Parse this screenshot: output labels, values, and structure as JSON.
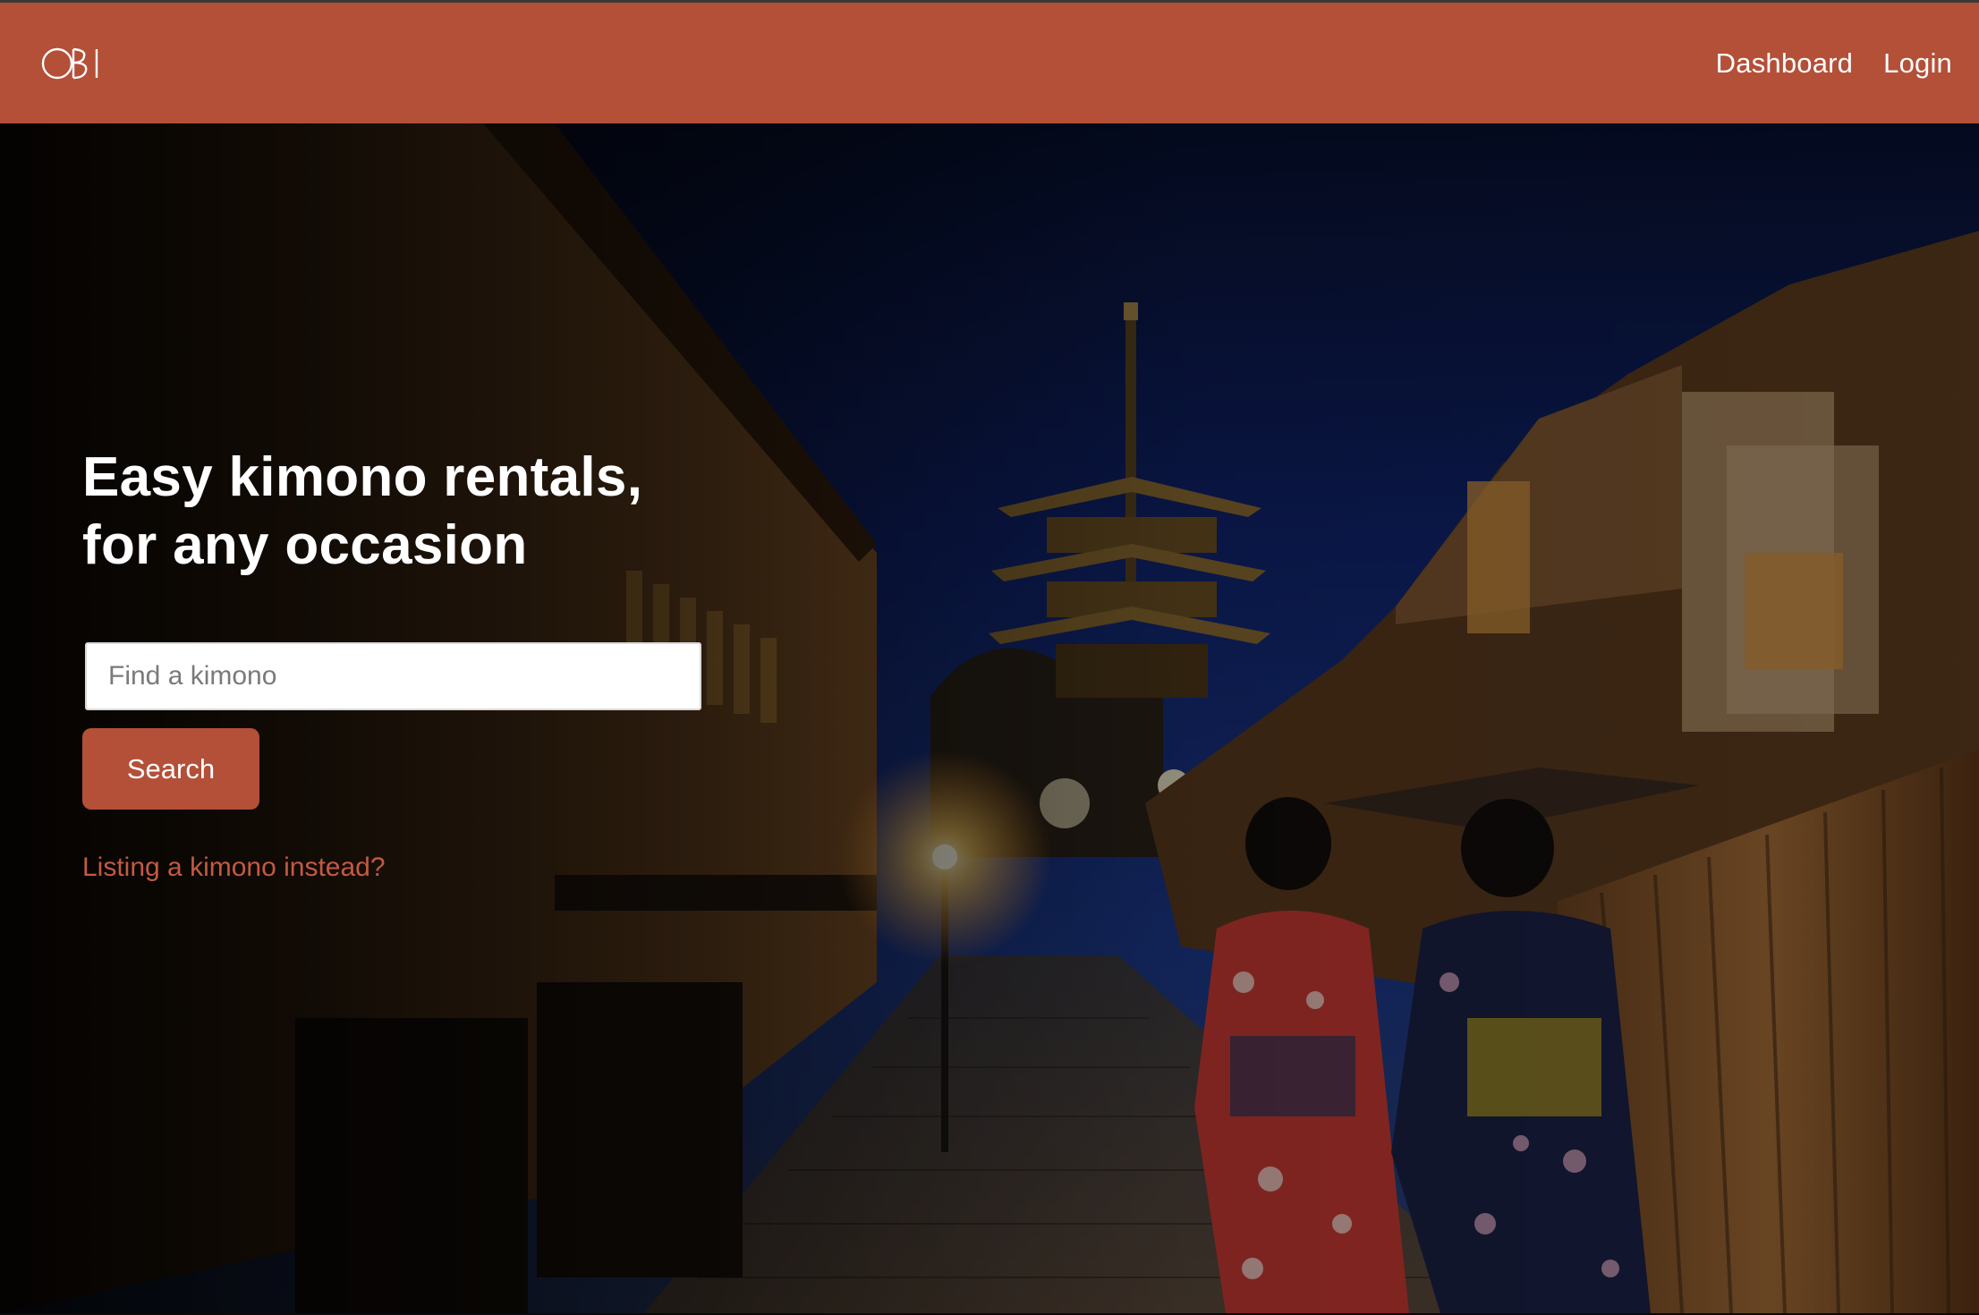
{
  "app": {
    "logo_text": "OBI",
    "brand_color": "#b44f38"
  },
  "nav": {
    "items": [
      {
        "label": "Dashboard"
      },
      {
        "label": "Login"
      }
    ]
  },
  "hero": {
    "headline_line1": "Easy kimono rentals,",
    "headline_line2": "for any occasion",
    "background_image": "kyoto-street-night-pagoda",
    "search": {
      "placeholder": "Find a kimono",
      "value": "",
      "button_label": "Search"
    },
    "listing_link": "Listing a kimono instead?"
  }
}
